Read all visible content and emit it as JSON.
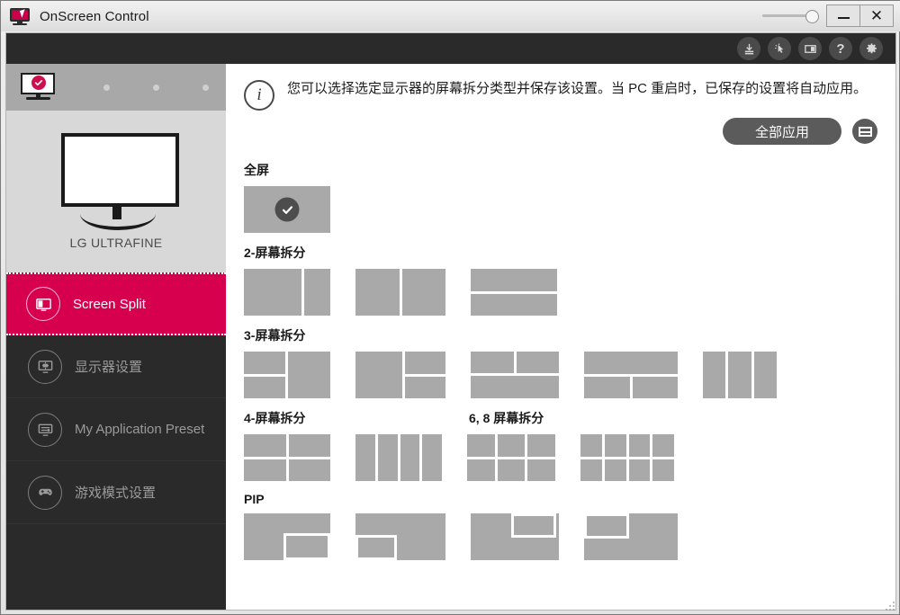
{
  "window": {
    "title": "OnScreen Control",
    "app_icon": "monitor-cursor-icon",
    "minimize_label": "–",
    "close_label": "✕",
    "opacity_slider_value": 100
  },
  "toolbar": {
    "icons": [
      {
        "name": "download-update-icon",
        "title": "Update"
      },
      {
        "name": "click-pointer-icon",
        "title": "Auto Pivot"
      },
      {
        "name": "screen-mode-icon",
        "title": "Screen Mode"
      },
      {
        "name": "help-icon",
        "title": "?",
        "glyph": "?"
      },
      {
        "name": "settings-gear-icon",
        "title": "Settings"
      }
    ]
  },
  "sidebar": {
    "monitor_strip": {
      "active_monitor_icon": "monitor-checked-icon",
      "inactive_dots": 3
    },
    "monitor_preview": {
      "icon": "monitor-large-icon",
      "name": "LG ULTRAFINE"
    },
    "items": [
      {
        "label": "Screen Split",
        "icon": "screen-split-icon",
        "active": true
      },
      {
        "label": "显示器设置",
        "icon": "monitor-settings-icon",
        "active": false
      },
      {
        "label": "My Application Preset",
        "icon": "application-preset-icon",
        "active": false
      },
      {
        "label": "游戏模式设置",
        "icon": "gamepad-icon",
        "active": false
      }
    ]
  },
  "main": {
    "info_icon": "info-icon",
    "info_text": "您可以选择选定显示器的屏幕拆分类型并保存该设置。当 PC 重启时，已保存的设置将自动应用。",
    "apply_all_label": "全部应用",
    "pbp_button_icon": "pbp-layout-icon",
    "sections": [
      {
        "id": "fullscreen",
        "title": "全屏"
      },
      {
        "id": "split2",
        "title": "2-屏幕拆分"
      },
      {
        "id": "split3",
        "title": "3-屏幕拆分"
      },
      {
        "id": "split4",
        "title": "4-屏幕拆分"
      },
      {
        "id": "split68",
        "title": "6, 8 屏幕拆分"
      },
      {
        "id": "pip",
        "title": "PIP"
      }
    ],
    "selected_layout": "fullscreen",
    "checkmark_icon": "check-icon"
  },
  "colors": {
    "brand_magenta": "#d6004f",
    "tile_gray": "#a9a9a9",
    "panel_dark": "#2a2a2a",
    "button_gray": "#5b5b5b"
  }
}
